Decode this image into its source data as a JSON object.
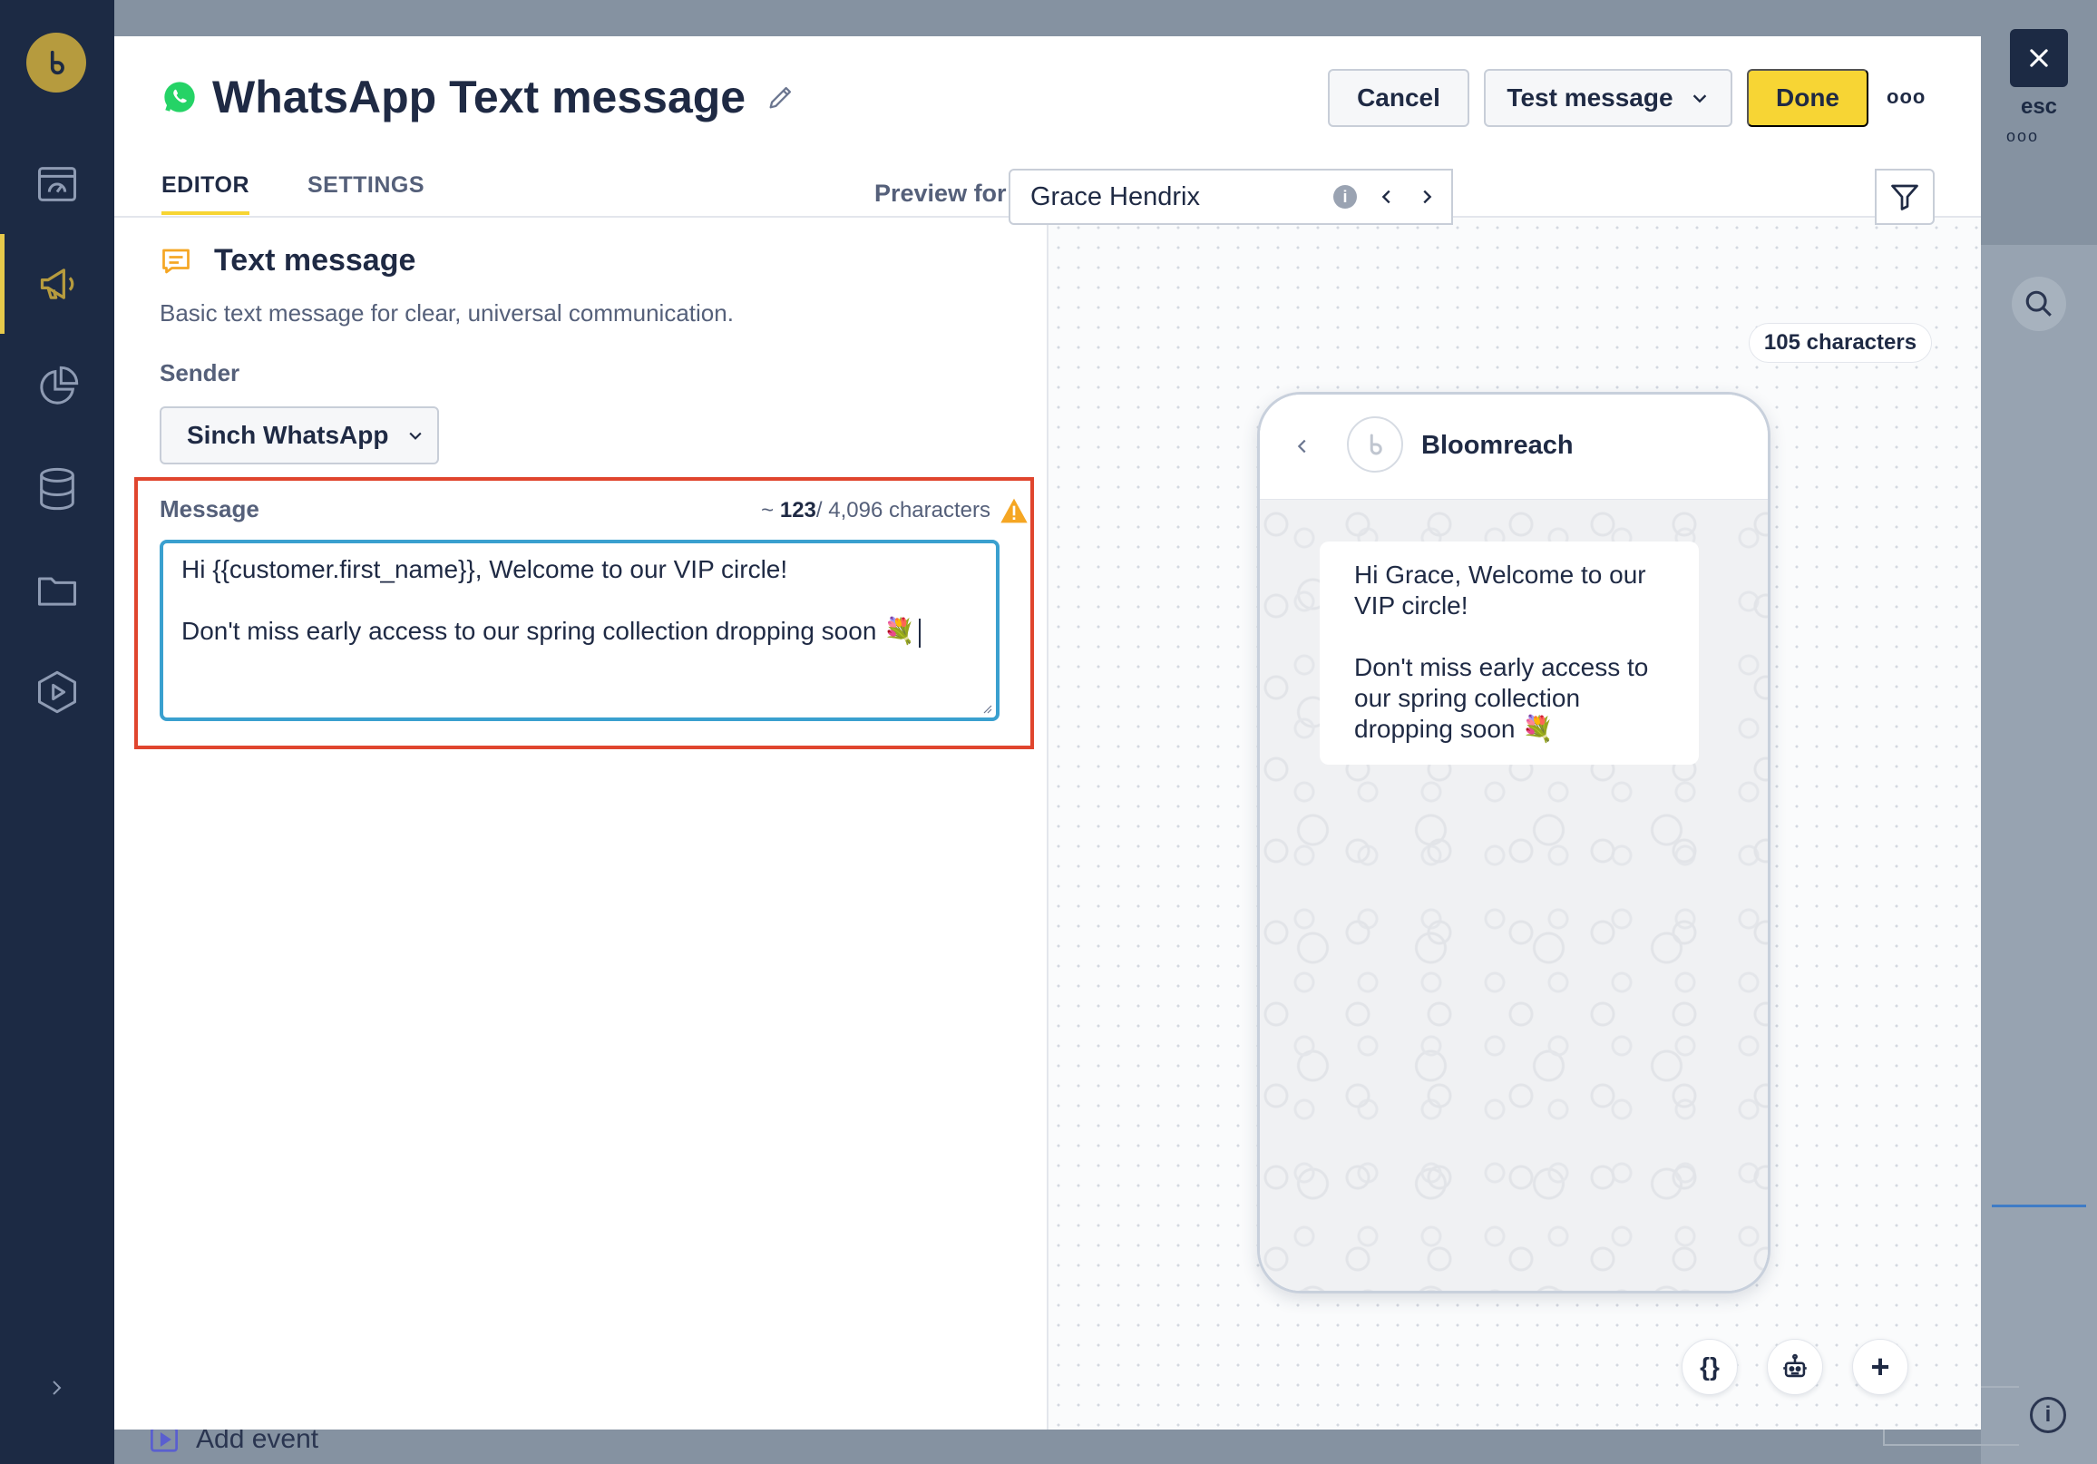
{
  "modal": {
    "title": "WhatsApp Text message",
    "buttons": {
      "cancel": "Cancel",
      "test": "Test message",
      "done": "Done",
      "more": "ooo"
    },
    "tabs": [
      {
        "label": "EDITOR",
        "active": true
      },
      {
        "label": "SETTINGS",
        "active": false
      }
    ]
  },
  "editor": {
    "section_title": "Text message",
    "section_desc": "Basic text message for clear, universal communication.",
    "sender_label": "Sender",
    "sender_value": "Sinch WhatsApp",
    "message_label": "Message",
    "message_count_prefix": "~",
    "message_count": "123",
    "message_count_suffix": "/ 4,096 characters",
    "message_line1": "Hi {{customer.first_name}}, Welcome to our VIP circle!",
    "message_line2": "Don't miss early access to our spring collection dropping soon 💐"
  },
  "preview": {
    "label": "Preview for",
    "customer": "Grace Hendrix",
    "char_count": "105 characters",
    "sender_name": "Bloomreach",
    "bubble_line1": "Hi Grace, Welcome to our VIP circle!",
    "bubble_line2": "Don't miss early access to our spring collection dropping soon 💐"
  },
  "toolbar": {
    "braces": "{}",
    "add": "+"
  },
  "background": {
    "add_event": "Add event",
    "esc_label": "esc",
    "esc_dots": "ooo"
  },
  "colors": {
    "nav_bg": "#1c2a44",
    "accent_yellow": "#f7d534",
    "highlight_red": "#e0452e",
    "focus_blue": "#3aa0cf",
    "whatsapp_green": "#25d366",
    "warning_orange": "#f5a623"
  }
}
